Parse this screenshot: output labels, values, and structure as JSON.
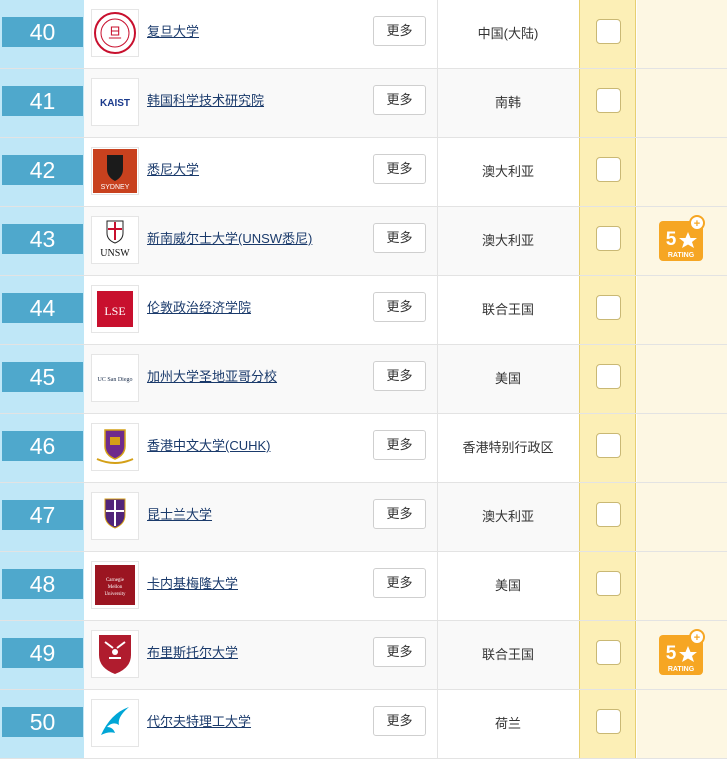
{
  "more_label": "更多",
  "rows": [
    {
      "rank": "40",
      "name": "复旦大学",
      "country": "中国(大陆)",
      "logo": "fudan-logo",
      "rating": null
    },
    {
      "rank": "41",
      "name": "韩国科学技术研究院",
      "country": "南韩",
      "logo": "kaist-logo",
      "logo_text": "KAIST",
      "rating": null
    },
    {
      "rank": "42",
      "name": "悉尼大学",
      "country": "澳大利亚",
      "logo": "sydney-logo",
      "logo_text": "SYDNEY",
      "rating": null
    },
    {
      "rank": "43",
      "name": "新南威尔士大学(UNSW悉尼)",
      "country": "澳大利亚",
      "logo": "unsw-logo",
      "logo_text": "UNSW",
      "rating": {
        "value": "5",
        "label": "RATING"
      }
    },
    {
      "rank": "44",
      "name": "伦敦政治经济学院",
      "country": "联合王国",
      "logo": "lse-logo",
      "logo_text": "LSE",
      "rating": null
    },
    {
      "rank": "45",
      "name": "加州大学圣地亚哥分校",
      "country": "美国",
      "logo": "ucsd-logo",
      "logo_text": "UC San Diego",
      "rating": null
    },
    {
      "rank": "46",
      "name": "香港中文大学(CUHK)",
      "country": "香港特别行政区",
      "logo": "cuhk-logo",
      "rating": null
    },
    {
      "rank": "47",
      "name": "昆士兰大学",
      "country": "澳大利亚",
      "logo": "uq-logo",
      "rating": null
    },
    {
      "rank": "48",
      "name": "卡内基梅隆大学",
      "country": "美国",
      "logo": "cmu-logo",
      "logo_text": "Carnegie Mellon University",
      "rating": null
    },
    {
      "rank": "49",
      "name": "布里斯托尔大学",
      "country": "联合王国",
      "logo": "bristol-logo",
      "rating": {
        "value": "5",
        "label": "RATING"
      }
    },
    {
      "rank": "50",
      "name": "代尔夫特理工大学",
      "country": "荷兰",
      "logo": "delft-logo",
      "rating": null
    }
  ],
  "colors": {
    "rank_bg": "#4fa8cc",
    "strip_bg": "#bfe7f7",
    "check_col_bg": "#fcefb6",
    "badge_bg": "#f6a623"
  }
}
